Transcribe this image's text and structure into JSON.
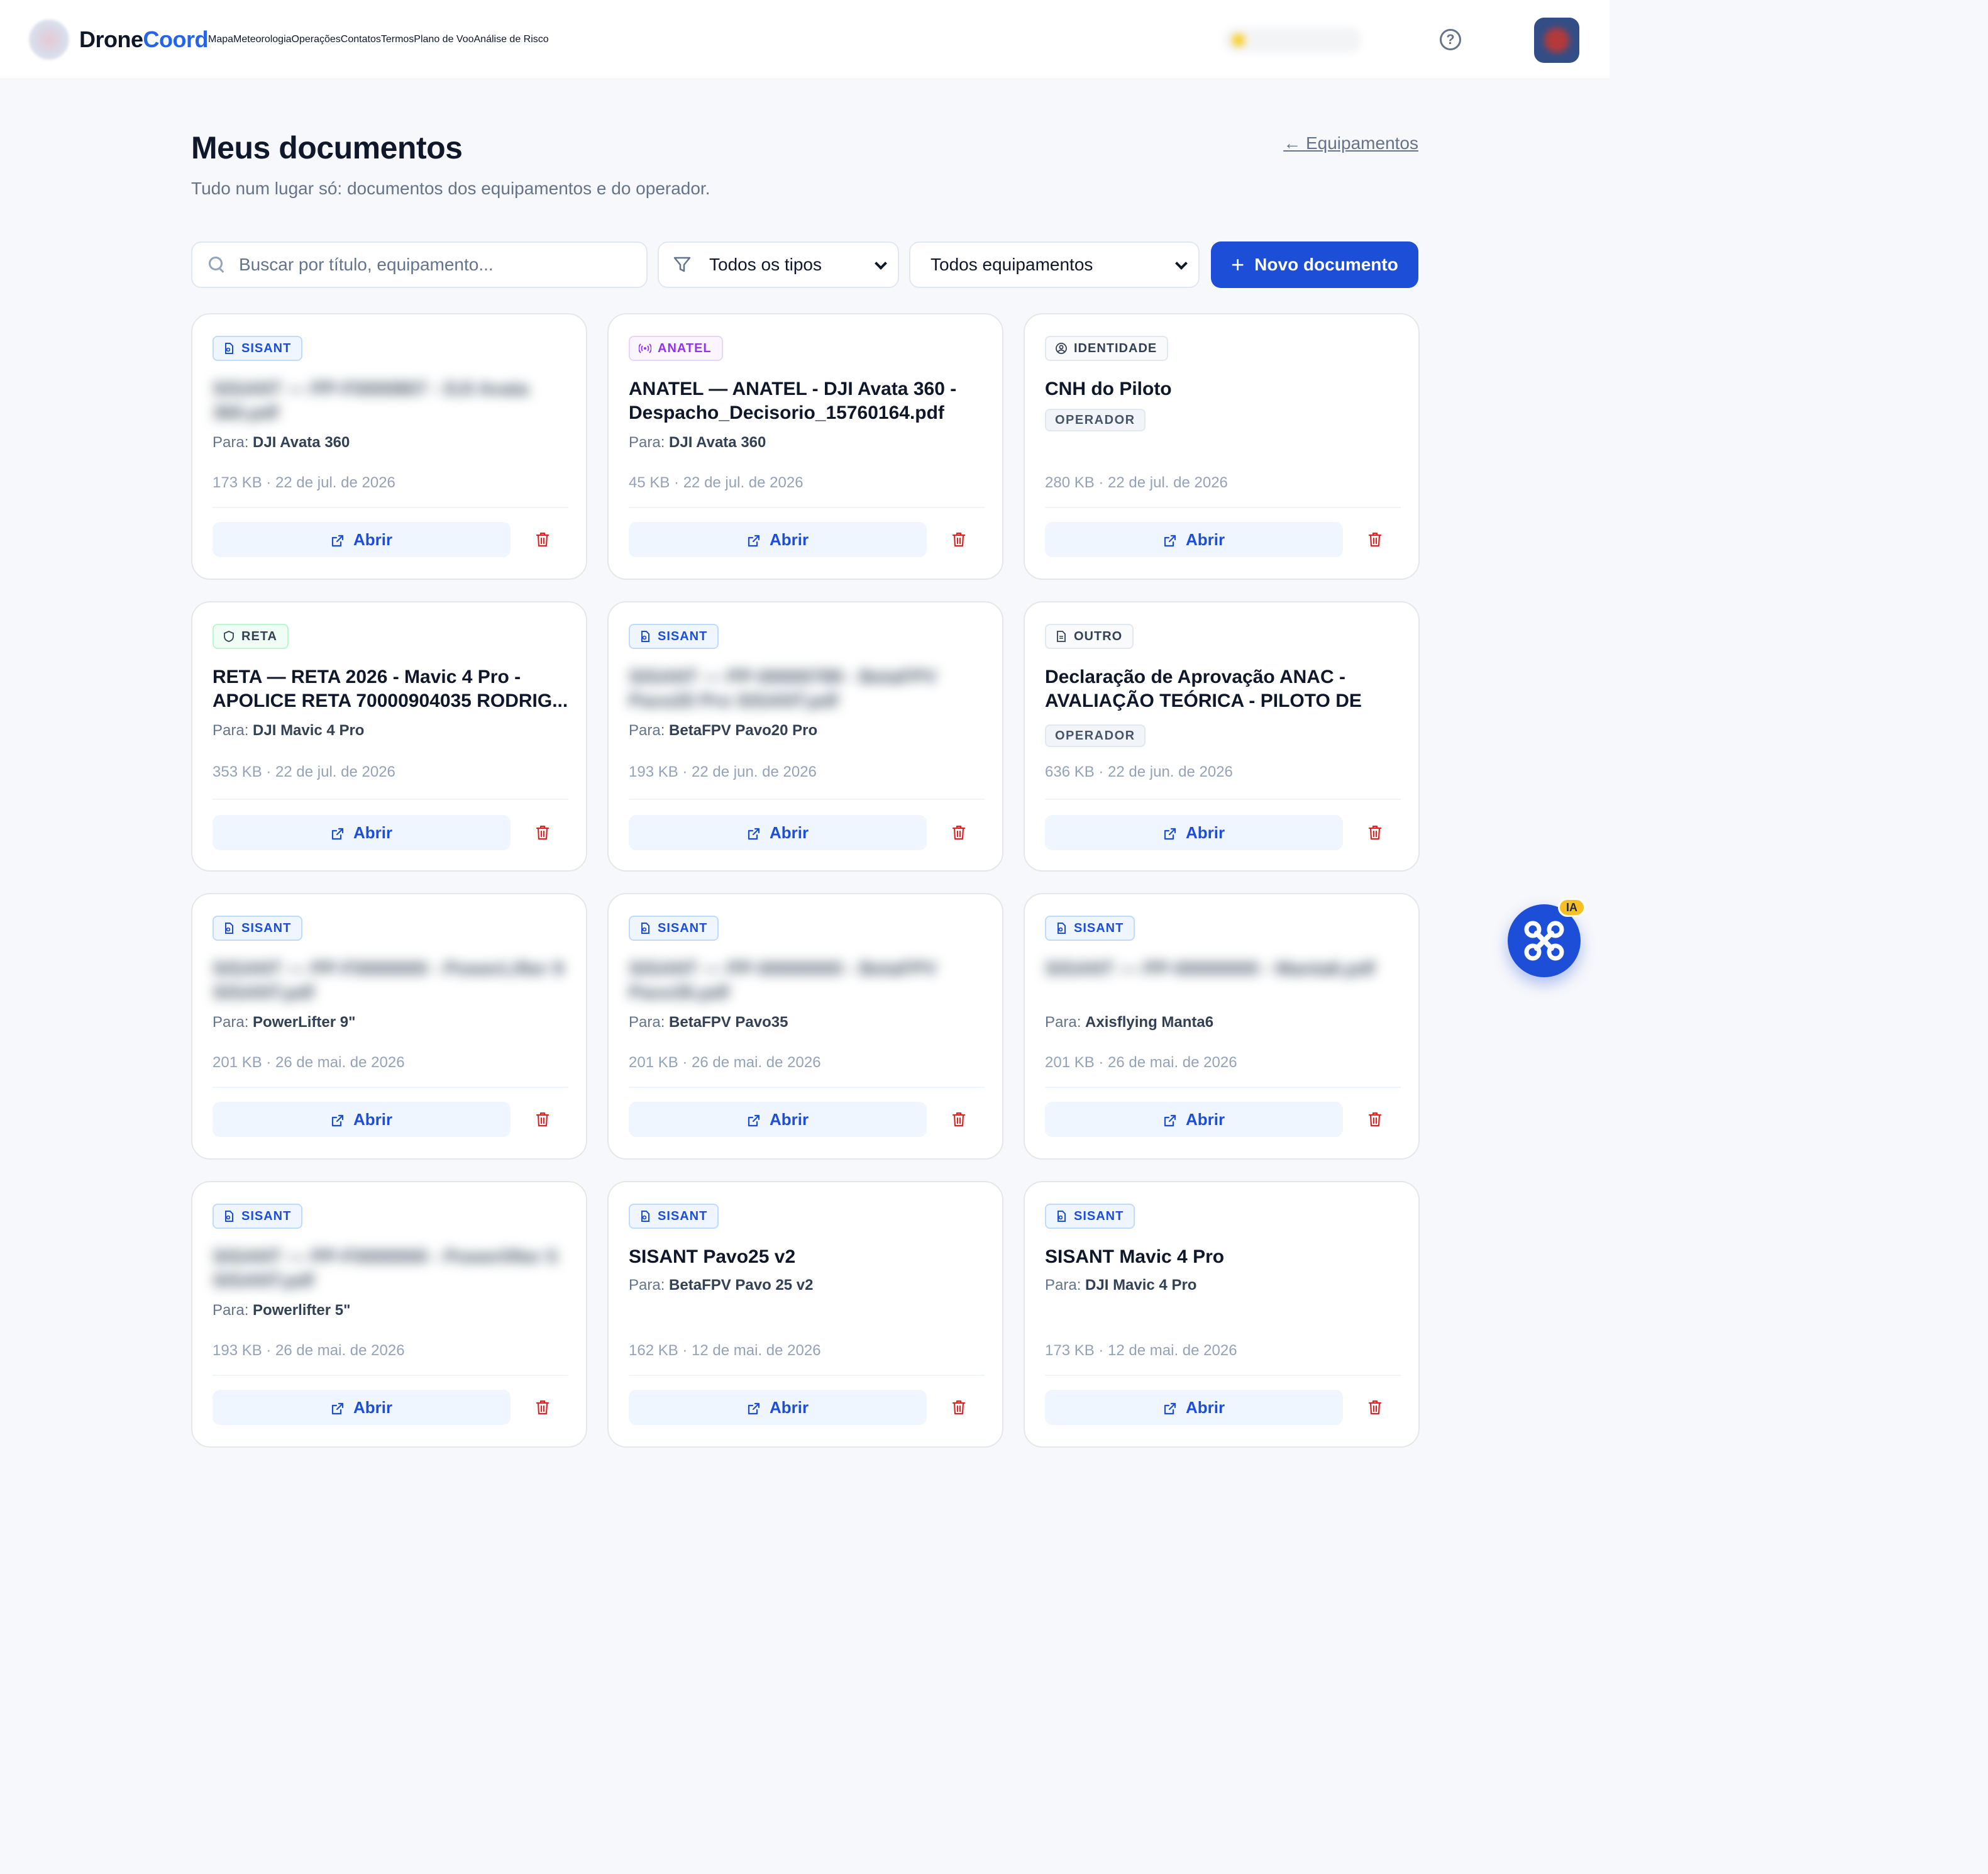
{
  "app": {
    "name_part1": "Drone",
    "name_part2": "Coord"
  },
  "nav": [
    {
      "label": "Mapa"
    },
    {
      "label": "Meteorologia"
    },
    {
      "label": "Operações"
    },
    {
      "label": "Contatos"
    },
    {
      "label": "Termos"
    },
    {
      "label": "Plano de Voo"
    },
    {
      "label": "Análise de Risco"
    }
  ],
  "header": {
    "title": "Meus documentos",
    "subtitle": "Tudo num lugar só: documentos dos equipamentos e do operador.",
    "back_link": "← Equipamentos"
  },
  "filters": {
    "search_placeholder": "Buscar por título, equipamento...",
    "type_select": "Todos os tipos",
    "equipment_select": "Todos equipamentos",
    "new_button": "Novo documento"
  },
  "labels": {
    "para": "Para:",
    "open": "Abrir",
    "operator_badge": "OPERADOR"
  },
  "colors": {
    "primary": "#1d4ed8",
    "danger": "#dc2626",
    "sisant": "#1d4ed8",
    "anatel": "#9333ea"
  },
  "documents": [
    {
      "type": "SISANT",
      "icon": "file-badge-icon",
      "title": "SISANT — PP-F0000807 - DJI Avata 360.pdf",
      "blurred": true,
      "para": "DJI Avata 360",
      "meta": "173 KB · 22 de jul. de 2026"
    },
    {
      "type": "ANATEL",
      "icon": "radio-icon",
      "title": "ANATEL — ANATEL - DJI Avata 360 - Despacho_Decisorio_15760164.pdf",
      "blurred": false,
      "para": "DJI Avata 360",
      "meta": "45 KB · 22 de jul. de 2026"
    },
    {
      "type": "IDENTIDADE",
      "icon": "user-circle-icon",
      "title": "CNH do Piloto",
      "blurred": false,
      "operator": true,
      "meta": "280 KB · 22 de jul. de 2026"
    },
    {
      "type": "RETA",
      "icon": "shield-icon",
      "title": "RETA — RETA 2026 - Mavic 4 Pro - APOLICE RETA 70000904035 RODRIG...",
      "blurred": false,
      "para": "DJI Mavic 4 Pro",
      "meta": "353 KB · 22 de jul. de 2026"
    },
    {
      "type": "SISANT",
      "icon": "file-badge-icon",
      "title": "SISANT — PP-00000789 - BetaFPV Pavo20 Pro SISANT.pdf",
      "blurred": true,
      "para": "BetaFPV Pavo20 Pro",
      "meta": "193 KB · 22 de jun. de 2026"
    },
    {
      "type": "OUTRO",
      "icon": "file-text-icon",
      "title": "Declaração de Aprovação ANAC - AVALIAÇÃO TEÓRICA - PILOTO DE DRONE",
      "blurred": false,
      "operator": true,
      "meta": "636 KB · 22 de jun. de 2026"
    },
    {
      "type": "SISANT",
      "icon": "file-badge-icon",
      "title": "SISANT — PP-F0000000 - PowerLifter 9 SISANT.pdf",
      "blurred": true,
      "para": "PowerLifter 9\"",
      "meta": "201 KB · 26 de mai. de 2026"
    },
    {
      "type": "SISANT",
      "icon": "file-badge-icon",
      "title": "SISANT — PP-00000000 - BetaFPV Pavo35.pdf",
      "blurred": true,
      "para": "BetaFPV Pavo35",
      "meta": "201 KB · 26 de mai. de 2026"
    },
    {
      "type": "SISANT",
      "icon": "file-badge-icon",
      "title": "SISANT — PP-00000000 - Manta6.pdf",
      "blurred": true,
      "para": "Axisflying Manta6",
      "meta": "201 KB · 26 de mai. de 2026"
    },
    {
      "type": "SISANT",
      "icon": "file-badge-icon",
      "title": "SISANT — PP-F0000000 - Powerlifter 5 SISANT.pdf",
      "blurred": true,
      "para": "Powerlifter 5\"",
      "meta": "193 KB · 26 de mai. de 2026"
    },
    {
      "type": "SISANT",
      "icon": "file-badge-icon",
      "title": "SISANT Pavo25 v2",
      "blurred": false,
      "para": "BetaFPV Pavo 25 v2",
      "meta": "162 KB · 12 de mai. de 2026"
    },
    {
      "type": "SISANT",
      "icon": "file-badge-icon",
      "title": "SISANT Mavic 4 Pro",
      "blurred": false,
      "para": "DJI Mavic 4 Pro",
      "meta": "173 KB · 12 de mai. de 2026"
    }
  ],
  "assistant": {
    "badge": "IA"
  }
}
